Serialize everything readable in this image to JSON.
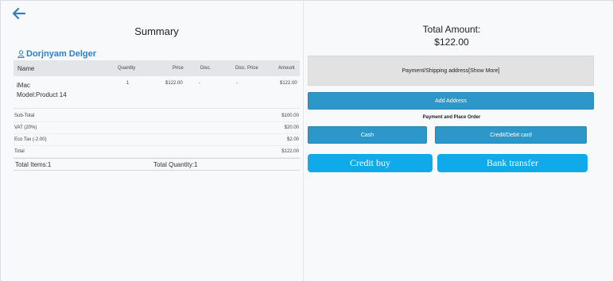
{
  "summary": {
    "title": "Summary",
    "customer_name": "Dorjnyam Delger",
    "columns": [
      "Name",
      "Quantity",
      "Price",
      "Disc.",
      "Disc. Price",
      "Amount"
    ],
    "items": [
      {
        "name": "iMac",
        "model": "Model:Product 14",
        "quantity": "1",
        "price": "$122.00",
        "disc": "-",
        "disc_price": "-",
        "amount": "$122.00"
      }
    ],
    "totals": [
      {
        "label": "Sub-Total",
        "value": "$100.00"
      },
      {
        "label": "VAT (20%)",
        "value": "$20.00"
      },
      {
        "label": "Eco Tax (-2.00)",
        "value": "$2.00"
      },
      {
        "label": "Total",
        "value": "$122.00"
      }
    ],
    "total_items": "Total Items:1",
    "total_quantity": "Total Quantity:1"
  },
  "payment": {
    "total_label": "Total Amount:",
    "total_value": "$122.00",
    "payship_label": "Payment/Shipping address[Show More]",
    "add_address_label": "Add Address",
    "section_label": "Payment and Place Order",
    "cash_label": "Cash",
    "card_label": "Credit/Debit card",
    "credit_buy_label": "Credit buy",
    "bank_transfer_label": "Bank transfer"
  },
  "icons": {
    "back": "back-arrow-icon",
    "user": "user-icon"
  },
  "colors": {
    "accent": "#2e97c9",
    "bright_accent": "#0eaaea",
    "link": "#2f7fc7"
  }
}
